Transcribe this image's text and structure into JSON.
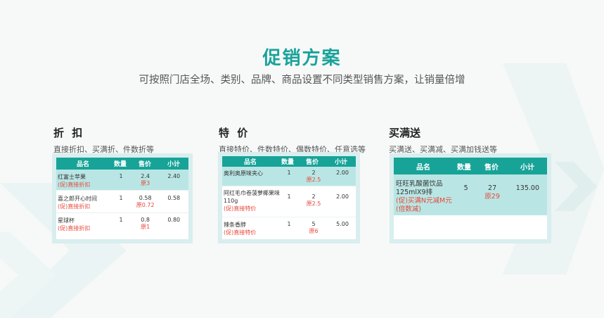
{
  "header": {
    "title": "促销方案",
    "subtitle": "可按照门店全场、类别、品牌、商品设置不同类型销售方案，让销量倍增"
  },
  "sections": [
    {
      "title": "折 扣",
      "desc": "直接折扣、买满折、件数折等",
      "columns": [
        "品名",
        "数量",
        "售价",
        "小计"
      ],
      "rows": [
        {
          "name": "红富士苹果",
          "promo": "(促)直接折扣",
          "qty": "1",
          "price": "2.4",
          "orig": "原3",
          "subtotal": "2.40"
        },
        {
          "name": "喜之郎开心时间",
          "promo": "(促)直接折扣",
          "qty": "1",
          "price": "0.58",
          "orig": "原0.72",
          "subtotal": "0.58"
        },
        {
          "name": "星球杯",
          "promo": "(促)直接折扣",
          "qty": "1",
          "price": "0.8",
          "orig": "原1",
          "subtotal": "0.80"
        }
      ]
    },
    {
      "title": "特 价",
      "desc": "直接特价、件数特价、偶数特价、任意选等",
      "columns": [
        "品名",
        "数量",
        "售价",
        "小计"
      ],
      "rows": [
        {
          "name": "奥利奥原味夹心",
          "promo": "",
          "qty": "1",
          "price": "2",
          "orig": "原2.5",
          "subtotal": "2.00"
        },
        {
          "name": "阿红毛巾卷菠萝椰果味110g",
          "promo": "(促)直接特价",
          "qty": "1",
          "price": "2",
          "orig": "原2.5",
          "subtotal": "2.00"
        },
        {
          "name": "辣条香脖",
          "promo": "(促)直接特价",
          "qty": "1",
          "price": "5",
          "orig": "原6",
          "subtotal": "5.00"
        }
      ]
    },
    {
      "title": "买满送",
      "desc": "买满送、买满减、买满加钱送等",
      "columns": [
        "品名",
        "数量",
        "售价",
        "小计"
      ],
      "rows": [
        {
          "name": "旺旺乳酸菌饮品125mlX9排",
          "promo": "(促)买满N元减M元(倍数减)",
          "qty": "5",
          "price": "27",
          "orig": "原29",
          "subtotal": "135.00"
        }
      ]
    }
  ],
  "colors": {
    "accent": "#1aa39a",
    "header_bg": "#17a398",
    "highlight_row": "#b9e6e4",
    "promo_red": "#e8483a",
    "card_bg": "#d9eeee"
  }
}
